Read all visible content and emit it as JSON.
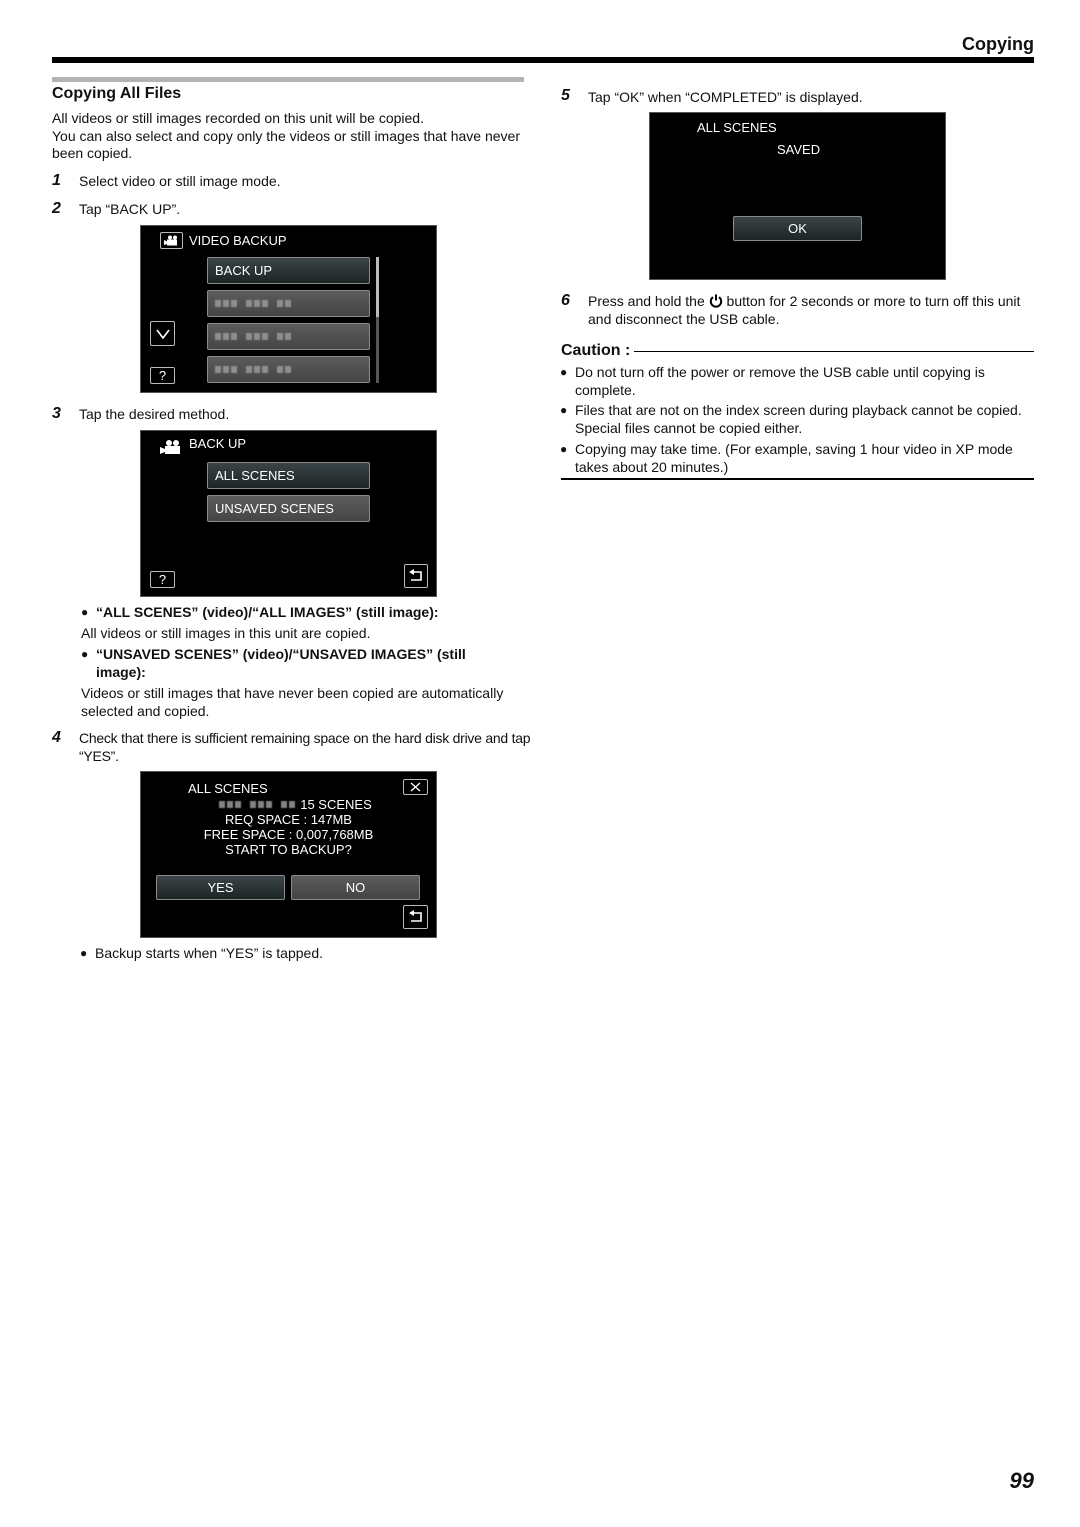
{
  "header": {
    "section_title": "Copying"
  },
  "section": {
    "title": "Copying All Files",
    "intro": [
      "All videos or still images recorded on this unit will be copied.",
      "You can also select and copy only the videos or still images that have never been copied."
    ]
  },
  "steps": [
    {
      "num": "1",
      "text": "Select video or still image mode."
    },
    {
      "num": "2",
      "text": "Tap “BACK UP”."
    },
    {
      "num": "3",
      "text": "Tap the desired method."
    },
    {
      "num": "4",
      "text": "Check that there is sufficient remaining space on the hard disk drive and tap “YES”."
    },
    {
      "num": "5",
      "text": "Tap “OK” when “COMPLETED” is displayed."
    },
    {
      "num": "6",
      "text_before": "Press and hold the",
      "text_after": "button for 2 seconds or more to turn off this unit and disconnect the USB cable.",
      "icon": "power-icon"
    }
  ],
  "screen1": {
    "title": "VIDEO BACKUP",
    "title_icon": "video-camera-icon",
    "items": [
      "BACK UP",
      "(blurred)",
      "(blurred)",
      "(blurred)"
    ],
    "down_icon": "chevron-down-icon",
    "help_label": "?"
  },
  "screen2": {
    "title": "BACK UP",
    "title_icon": "video-camera-icon",
    "items": [
      "ALL SCENES",
      "UNSAVED SCENES"
    ],
    "help_label": "?",
    "back_icon": "return-icon"
  },
  "options": [
    {
      "heading": "“ALL SCENES” (video)/“ALL IMAGES” (still image):",
      "desc": "All videos or still images in this unit are copied."
    },
    {
      "heading": "“UNSAVED SCENES” (video)/“UNSAVED IMAGES” (still image):",
      "desc": "Videos or still images that have never been copied are automatically selected and copied."
    }
  ],
  "screen3": {
    "title": "ALL SCENES",
    "scenes": "15 SCENES",
    "req_space": "REQ SPACE : 147MB",
    "free_space": "FREE SPACE : 0,007,768MB",
    "prompt": "START TO BACKUP?",
    "yes_label": "YES",
    "no_label": "NO",
    "close_icon": "close-icon",
    "back_icon": "return-icon"
  },
  "step4_note": "Backup starts when “YES” is tapped.",
  "screen4": {
    "title": "ALL SCENES",
    "status": "SAVED",
    "ok_label": "OK"
  },
  "caution": {
    "title": "Caution :",
    "items": [
      "Do not turn off the power or remove the USB cable until copying is complete.",
      "Files that are not on the index screen during playback cannot be copied. Special files cannot be copied either.",
      "Copying may take time. (For example, saving 1 hour video in XP mode takes about 20 minutes.)"
    ]
  },
  "page_number": "99"
}
